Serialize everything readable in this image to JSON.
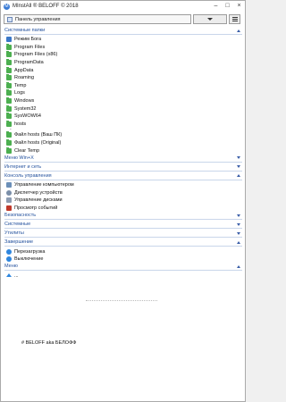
{
  "window": {
    "title": "MInstAll ® BELOFF © 2018",
    "app_icon": "app-icon"
  },
  "toolbar": {
    "select_value": "Панель управления",
    "dropdown_icon": "chevron-down-icon",
    "menu_icon": "hamburger-icon"
  },
  "sections": [
    {
      "title": "Системные папки",
      "state": "expanded",
      "items": [
        {
          "label": "Режим Бога",
          "icon": "god-mode-icon"
        },
        {
          "label": "Program Files",
          "icon": "folder-icon"
        },
        {
          "label": "Program Files (x86)",
          "icon": "folder-icon"
        },
        {
          "label": "ProgramData",
          "icon": "folder-icon"
        },
        {
          "label": "AppData",
          "icon": "folder-icon"
        },
        {
          "label": "Roaming",
          "icon": "folder-icon"
        },
        {
          "label": "Temp",
          "icon": "folder-icon"
        },
        {
          "label": "Logs",
          "icon": "folder-icon"
        },
        {
          "label": "Windows",
          "icon": "folder-icon"
        },
        {
          "label": "System32",
          "icon": "folder-icon"
        },
        {
          "label": "SysWOW64",
          "icon": "folder-icon"
        },
        {
          "label": "hosts",
          "icon": "folder-icon"
        },
        {
          "label": "-",
          "icon": "separator"
        },
        {
          "label": "Файл hosts (Ваш ПК)",
          "icon": "folder-icon"
        },
        {
          "label": "Файл hosts (Original)",
          "icon": "folder-icon"
        },
        {
          "label": "Clear Temp",
          "icon": "folder-icon"
        }
      ]
    },
    {
      "title": "Меню Win+X",
      "state": "collapsed",
      "items": []
    },
    {
      "title": "Интернет и сеть",
      "state": "collapsed",
      "items": []
    },
    {
      "title": "Консоль управления",
      "state": "expanded",
      "items": [
        {
          "label": "Управление компьютером",
          "icon": "computer-management-icon"
        },
        {
          "label": "Диспетчер устройств",
          "icon": "device-manager-icon"
        },
        {
          "label": "Управление дисками",
          "icon": "disk-management-icon"
        },
        {
          "label": "Просмотр событий",
          "icon": "event-viewer-icon"
        }
      ]
    },
    {
      "title": "Безопасность",
      "state": "collapsed",
      "items": []
    },
    {
      "title": "Системные",
      "state": "collapsed",
      "items": []
    },
    {
      "title": "Утилиты",
      "state": "collapsed",
      "items": []
    },
    {
      "title": "Завершение",
      "state": "expanded",
      "items": [
        {
          "label": "Перезагрузка",
          "icon": "restart-icon"
        },
        {
          "label": "Выключение",
          "icon": "power-icon"
        }
      ]
    },
    {
      "title": "Меню",
      "state": "expanded",
      "items": [
        {
          "label": "...",
          "icon": "up-arrow-icon"
        }
      ]
    }
  ],
  "footer": {
    "text": "# BELOFF aka БЕЛОФФ"
  },
  "colors": {
    "section_header": "#1f4e9c",
    "folder": "#4caf50",
    "accent": "#2e86de"
  }
}
